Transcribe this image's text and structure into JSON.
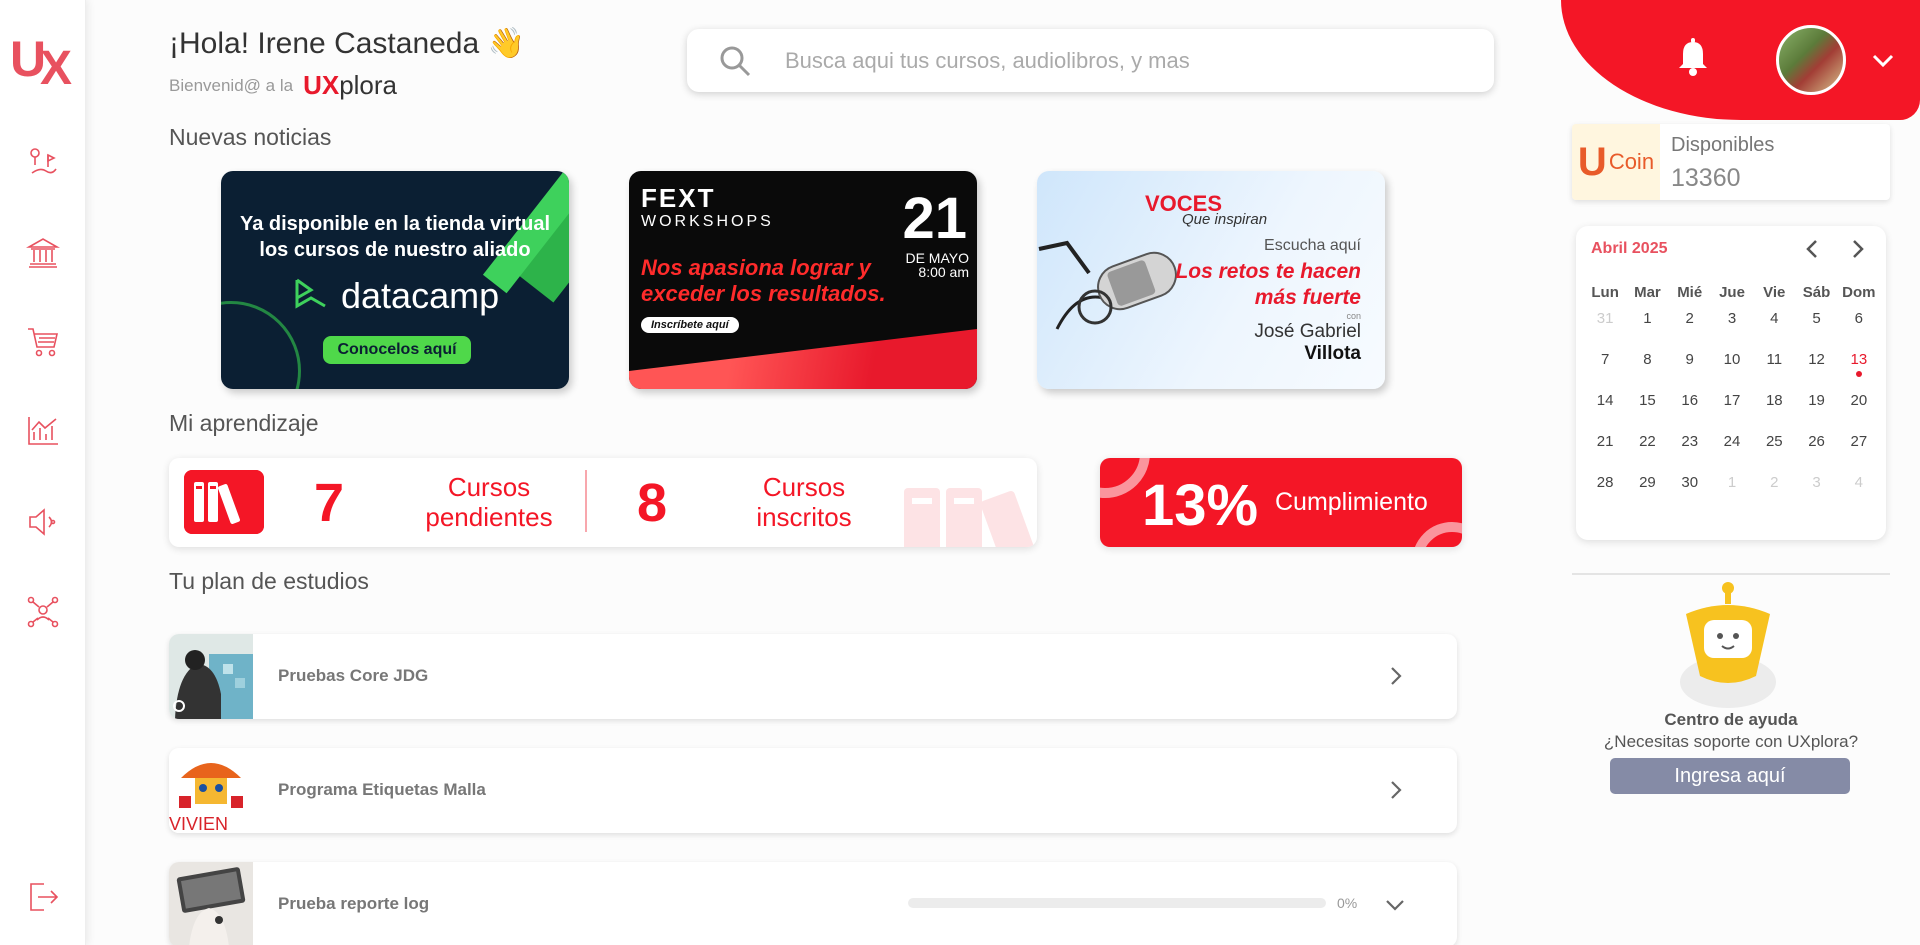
{
  "header": {
    "greeting": "¡Hola! Irene Castaneda",
    "greeting_emoji": "👋",
    "welcome": "Bienvenid@ a la",
    "brand_ux": "UX",
    "brand_rest": "plora",
    "search_placeholder": "Busca aqui tus cursos, audiolibros, y mas"
  },
  "sidebar": {
    "logo": "UX",
    "items": [
      {
        "icon": "route-icon"
      },
      {
        "icon": "bank-icon"
      },
      {
        "icon": "cart-icon"
      },
      {
        "icon": "chart-icon"
      },
      {
        "icon": "speaker-icon"
      },
      {
        "icon": "network-icon"
      }
    ],
    "logout_icon": "logout-icon"
  },
  "sections": {
    "news": "Nuevas noticias",
    "learning": "Mi aprendizaje",
    "plan": "Tu plan de estudios"
  },
  "news": [
    {
      "text_line1": "Ya disponible en la tienda virtual",
      "text_line2": "los cursos de nuestro aliado",
      "brand": "datacamp",
      "button": "Conocelos aquí"
    },
    {
      "logo": "FEXT",
      "logo_sub": "WORKSHOPS",
      "day": "21",
      "month": "DE MAYO",
      "time": "8:00 am",
      "line1": "Nos apasiona lograr y",
      "line2": "exceder los resultados.",
      "chip": "Inscríbete aquí"
    },
    {
      "title": "VOCES",
      "subtitle": "Que inspiran",
      "listen": "Escucha aquí",
      "line1": "Los retos te hacen",
      "line2": "más fuerte",
      "con": "con",
      "name1": "José Gabriel",
      "name2": "Villota"
    }
  ],
  "learning": {
    "pending_count": "7",
    "pending_label_1": "Cursos",
    "pending_label_2": "pendientes",
    "enrolled_count": "8",
    "enrolled_label_1": "Cursos",
    "enrolled_label_2": "inscritos",
    "completion": "13%",
    "completion_label": "Cumplimiento"
  },
  "plan": [
    {
      "title": "Pruebas Core JDG",
      "action_icon": "chevron-right-icon"
    },
    {
      "title": "Programa Etiquetas Malla",
      "action_icon": "chevron-right-icon"
    },
    {
      "title": "Prueba reporte log",
      "progress": 0,
      "progress_text": "0%",
      "action_icon": "chevron-down-icon"
    }
  ],
  "coin": {
    "badge_u": "U",
    "badge_coin": "Coin",
    "label": "Disponibles",
    "value": "13360"
  },
  "calendar": {
    "title": "Abril 2025",
    "weekdays": [
      "Lun",
      "Mar",
      "Mié",
      "Jue",
      "Vie",
      "Sáb",
      "Dom"
    ],
    "days": [
      {
        "d": "31",
        "muted": true
      },
      {
        "d": "1"
      },
      {
        "d": "2"
      },
      {
        "d": "3"
      },
      {
        "d": "4"
      },
      {
        "d": "5"
      },
      {
        "d": "6"
      },
      {
        "d": "7"
      },
      {
        "d": "8"
      },
      {
        "d": "9"
      },
      {
        "d": "10"
      },
      {
        "d": "11"
      },
      {
        "d": "12"
      },
      {
        "d": "13",
        "today": true
      },
      {
        "d": "14"
      },
      {
        "d": "15"
      },
      {
        "d": "16"
      },
      {
        "d": "17"
      },
      {
        "d": "18"
      },
      {
        "d": "19"
      },
      {
        "d": "20"
      },
      {
        "d": "21"
      },
      {
        "d": "22"
      },
      {
        "d": "23"
      },
      {
        "d": "24"
      },
      {
        "d": "25"
      },
      {
        "d": "26"
      },
      {
        "d": "27"
      },
      {
        "d": "28"
      },
      {
        "d": "29"
      },
      {
        "d": "30"
      },
      {
        "d": "1",
        "muted": true
      },
      {
        "d": "2",
        "muted": true
      },
      {
        "d": "3",
        "muted": true
      },
      {
        "d": "4",
        "muted": true
      }
    ]
  },
  "help": {
    "title": "Centro de ayuda",
    "subtitle": "¿Necesitas soporte con UXplora?",
    "button": "Ingresa aquí"
  },
  "colors": {
    "accent": "#f41626",
    "accent_soft": "#e8515f",
    "help_button": "#858ba6"
  }
}
